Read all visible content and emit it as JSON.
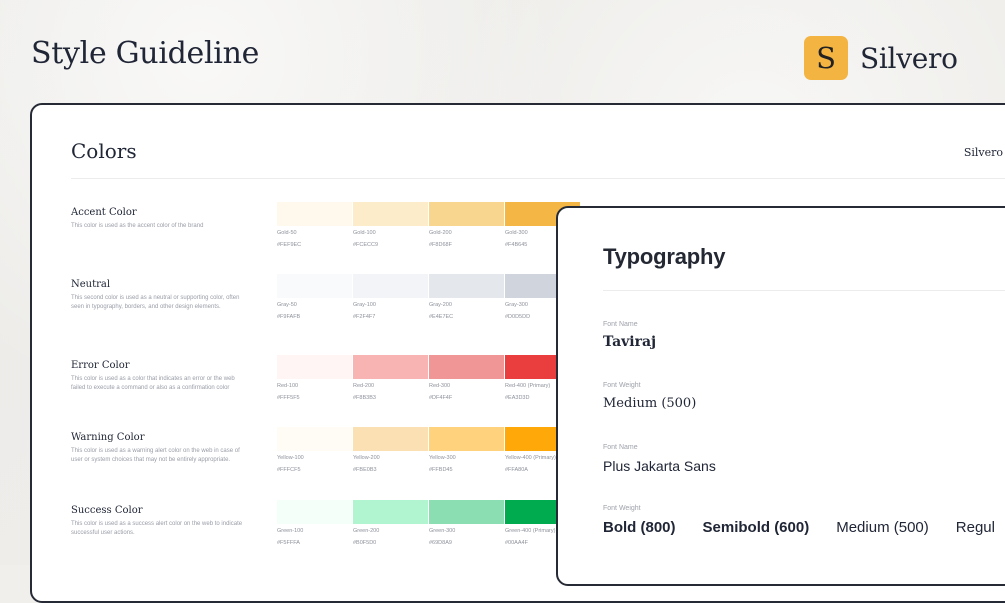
{
  "header": {
    "title": "Style Guideline",
    "brand_mark": "S",
    "brand_name": "Silvero"
  },
  "colors_panel": {
    "title": "Colors",
    "brand_name": "Silvero",
    "sections": [
      {
        "title": "Accent Color",
        "description": "This color is used as the accent color of the brand",
        "swatches": [
          {
            "name": "Gold-50",
            "hex": "#FEF9EC",
            "color": "#FEF9EC"
          },
          {
            "name": "Gold-100",
            "hex": "#FCECC9",
            "color": "#FCECC9"
          },
          {
            "name": "Gold-200",
            "hex": "#F8D68F",
            "color": "#F8D68F"
          },
          {
            "name": "Gold-300",
            "hex": "#F4B645",
            "color": "#F4B645"
          }
        ]
      },
      {
        "title": "Neutral",
        "description": "This second color is used as a neutral or supporting color, often seen in typography, borders, and other design elements.",
        "swatches": [
          {
            "name": "Gray-50",
            "hex": "#F9FAFB",
            "color": "#F9FAFB"
          },
          {
            "name": "Gray-100",
            "hex": "#F2F4F7",
            "color": "#F2F4F7"
          },
          {
            "name": "Gray-200",
            "hex": "#E4E7EC",
            "color": "#E4E7EC"
          },
          {
            "name": "Gray-300",
            "hex": "#D0D5DD",
            "color": "#D0D5DD"
          }
        ]
      },
      {
        "title": "Error Color",
        "description": "This color is used as a color that indicates an error or the web failed to execute a command or also as a confirmation color",
        "swatches": [
          {
            "name": "Red-100",
            "hex": "#FFF5F5",
            "color": "#FFF5F5"
          },
          {
            "name": "Red-200",
            "hex": "#F8B3B3",
            "color": "#F8B3B3"
          },
          {
            "name": "Red-300",
            "hex": "#DF4F4F",
            "color": "#F09696"
          },
          {
            "name": "Red-400 (Primary)",
            "hex": "#EA3D3D",
            "color": "#EA3D3D"
          }
        ]
      },
      {
        "title": "Warning Color",
        "description": "This color is used as a warning alert color on the web in case of user or system choices that may not be entirely appropriate.",
        "swatches": [
          {
            "name": "Yellow-100",
            "hex": "#FFFCF5",
            "color": "#FFFCF5"
          },
          {
            "name": "Yellow-200",
            "hex": "#FBE0B3",
            "color": "#FBE0B3"
          },
          {
            "name": "Yellow-300",
            "hex": "#FFBD45",
            "color": "#FFD37D"
          },
          {
            "name": "Yellow-400 (Primary)",
            "hex": "#FFA80A",
            "color": "#FFA80A"
          }
        ]
      },
      {
        "title": "Success Color",
        "description": "This color is used as a success alert color on the web to indicate successful user actions.",
        "swatches": [
          {
            "name": "Green-100",
            "hex": "#F5FFFA",
            "color": "#F5FFFA"
          },
          {
            "name": "Green-200",
            "hex": "#B0F5D0",
            "color": "#B0F5D0"
          },
          {
            "name": "Green-300",
            "hex": "#69D8A9",
            "color": "#8BDDB2"
          },
          {
            "name": "Green-400 (Primary)",
            "hex": "#00AA4F",
            "color": "#00AA4F"
          }
        ]
      }
    ]
  },
  "typography_panel": {
    "title": "Typography",
    "font_name_label_1": "Font Name",
    "font_name_1": "Taviraj",
    "font_weight_label_1": "Font Weight",
    "font_weight_1": "Medium (500)",
    "font_name_label_2": "Font Name",
    "font_name_2": "Plus Jakarta Sans",
    "font_weight_label_2": "Font Weight",
    "weights": [
      "Bold (800)",
      "Semibold (600)",
      "Medium (500)",
      "Regul"
    ]
  }
}
